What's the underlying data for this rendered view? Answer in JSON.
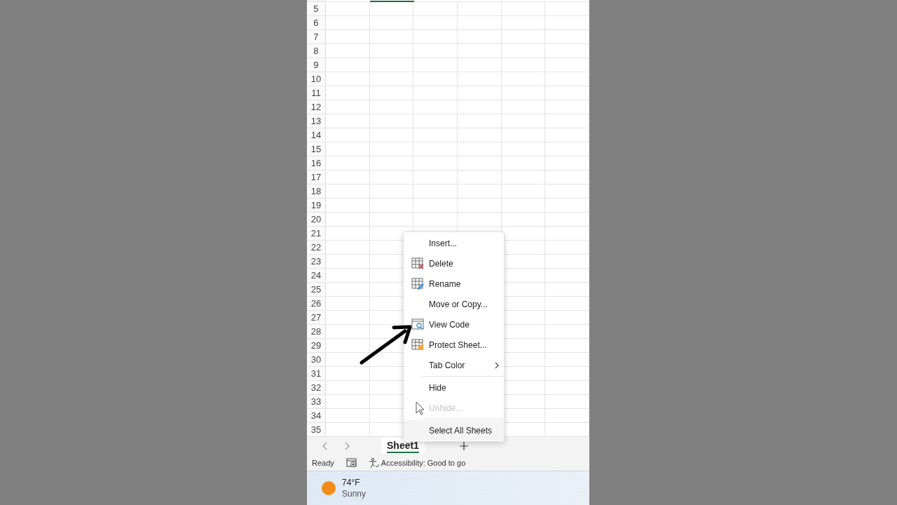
{
  "sheet": {
    "row_numbers": [
      "5",
      "6",
      "7",
      "8",
      "9",
      "10",
      "11",
      "12",
      "13",
      "14",
      "15",
      "16",
      "17",
      "18",
      "19",
      "20",
      "21",
      "22",
      "23",
      "24",
      "25",
      "26",
      "27",
      "28",
      "29",
      "30",
      "31",
      "32",
      "33",
      "34",
      "35"
    ]
  },
  "context_menu": {
    "items": [
      {
        "label": "Insert...",
        "disabled": false,
        "submenu": false,
        "separator_before": false
      },
      {
        "label": "Delete",
        "disabled": false,
        "submenu": false,
        "separator_before": false
      },
      {
        "label": "Rename",
        "disabled": false,
        "submenu": false,
        "separator_before": false
      },
      {
        "label": "Move or Copy...",
        "disabled": false,
        "submenu": false,
        "separator_before": false
      },
      {
        "label": "View Code",
        "disabled": false,
        "submenu": false,
        "separator_before": false
      },
      {
        "label": "Protect Sheet...",
        "disabled": false,
        "submenu": false,
        "separator_before": false
      },
      {
        "label": "Tab Color",
        "disabled": false,
        "submenu": true,
        "separator_before": false
      },
      {
        "label": "Hide",
        "disabled": false,
        "submenu": false,
        "separator_before": true
      },
      {
        "label": "Unhide...",
        "disabled": true,
        "submenu": false,
        "separator_before": false
      },
      {
        "label": "Select All Sheets",
        "disabled": false,
        "submenu": false,
        "separator_before": true
      }
    ]
  },
  "sheet_tabs": [
    {
      "label": "Sheet1",
      "selected": true
    }
  ],
  "status_bar": {
    "mode": "Ready",
    "accessibility": "Accessibility: Good to go"
  },
  "taskbar": {
    "temperature": "74°F",
    "condition": "Sunny"
  }
}
